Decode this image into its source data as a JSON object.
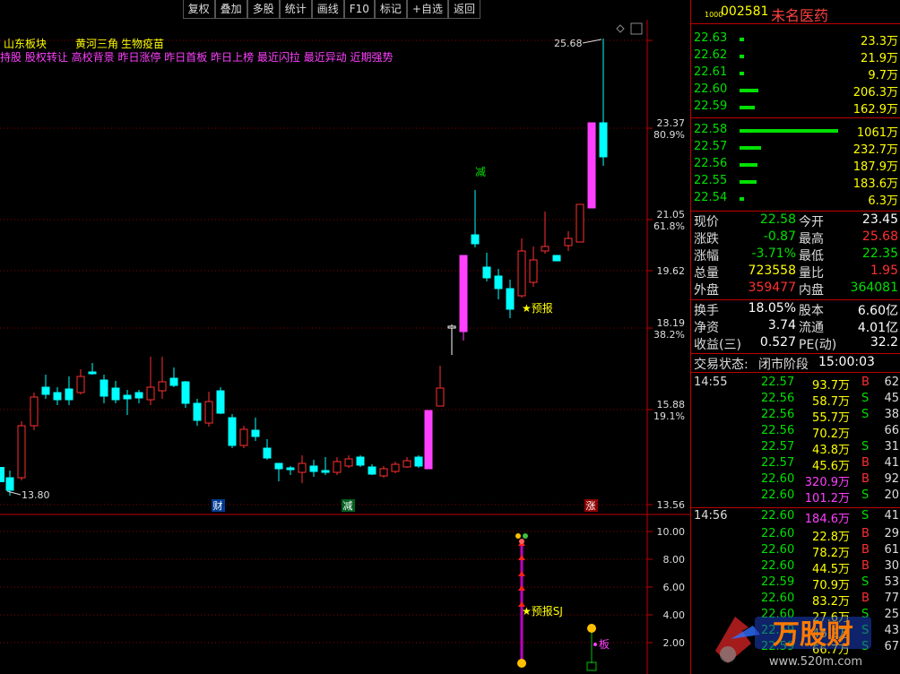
{
  "toolbar": {
    "buttons": [
      "复权",
      "叠加",
      "多股",
      "统计",
      "画线",
      "F10",
      "标记",
      "+自选",
      "返回"
    ]
  },
  "chart": {
    "blocks": [
      "山东板块",
      "黄河三角",
      "生物疫苗"
    ],
    "concepts": "持股 股权转让 高校背景 昨日涨停 昨日首板 昨日上榜 最近闪拉 最近异动 近期强势",
    "price_labels": [
      {
        "value": "25.68"
      },
      {
        "value": "23.37",
        "pct": "80.9%"
      },
      {
        "value": "21.05",
        "pct": "61.8%"
      },
      {
        "value": "19.62"
      },
      {
        "value": "18.19",
        "pct": "38.2%"
      },
      {
        "value": "15.88",
        "pct": "19.1%"
      },
      {
        "value": "13.56"
      }
    ],
    "low_label": "13.80",
    "high_label": "25.68",
    "markers": {
      "cai": "财",
      "jian1": "减",
      "jian2": "减",
      "zhang": "涨",
      "yubao": "★预报"
    },
    "sub_axis": [
      "10.00",
      "8.00",
      "6.00",
      "4.00",
      "2.00"
    ],
    "sub_labels": {
      "yubao_sj": "★预报SJ",
      "ban": "板"
    }
  },
  "stock": {
    "code": "002581",
    "name": "未名医药",
    "tag": "1000"
  },
  "orderbook": {
    "asks": [
      {
        "price": "22.63",
        "vol": "23.3万",
        "bar": 0.02
      },
      {
        "price": "22.62",
        "vol": "21.9万",
        "bar": 0.02
      },
      {
        "price": "22.61",
        "vol": "9.7万",
        "bar": 0.01
      },
      {
        "price": "22.60",
        "vol": "206.3万",
        "bar": 0.19
      },
      {
        "price": "22.59",
        "vol": "162.9万",
        "bar": 0.15
      }
    ],
    "bids": [
      {
        "price": "22.58",
        "vol": "1061万",
        "bar": 1.0
      },
      {
        "price": "22.57",
        "vol": "232.7万",
        "bar": 0.22
      },
      {
        "price": "22.56",
        "vol": "187.9万",
        "bar": 0.18
      },
      {
        "price": "22.55",
        "vol": "183.6万",
        "bar": 0.17
      },
      {
        "price": "22.54",
        "vol": "6.3万",
        "bar": 0.01
      }
    ]
  },
  "quote": [
    {
      "l1": "现价",
      "v1": "22.58",
      "c1": "g",
      "l2": "今开",
      "v2": "23.45",
      "c2": "w"
    },
    {
      "l1": "涨跌",
      "v1": "-0.87",
      "c1": "g",
      "l2": "最高",
      "v2": "25.68",
      "c2": "r"
    },
    {
      "l1": "涨幅",
      "v1": "-3.71%",
      "c1": "g",
      "l2": "最低",
      "v2": "22.35",
      "c2": "g"
    },
    {
      "l1": "总量",
      "v1": "723558",
      "c1": "y",
      "l2": "量比",
      "v2": "1.95",
      "c2": "r"
    },
    {
      "l1": "外盘",
      "v1": "359477",
      "c1": "r",
      "l2": "内盘",
      "v2": "364081",
      "c2": "g"
    }
  ],
  "quote2": [
    {
      "l1": "换手",
      "v1": "18.05%",
      "l2": "股本",
      "v2": "6.60亿"
    },
    {
      "l1": "净资",
      "v1": "3.74",
      "l2": "流通",
      "v2": "4.01亿"
    },
    {
      "l1": "收益(三)",
      "v1": "0.527",
      "l2": "PE(动)",
      "v2": "32.2"
    }
  ],
  "status": {
    "label": "交易状态:",
    "value": "闭市阶段",
    "time": "15:00:03"
  },
  "ticks": [
    {
      "time": "14:55",
      "price": "22.57",
      "vol": "93.7万",
      "vc": "y",
      "bs": "B",
      "num": "62"
    },
    {
      "time": "",
      "price": "22.56",
      "vol": "58.7万",
      "vc": "y",
      "bs": "S",
      "num": "45"
    },
    {
      "time": "",
      "price": "22.56",
      "vol": "55.7万",
      "vc": "y",
      "bs": "S",
      "num": "38"
    },
    {
      "time": "",
      "price": "22.56",
      "vol": "70.2万",
      "vc": "y",
      "bs": "",
      "num": "66"
    },
    {
      "time": "",
      "price": "22.57",
      "vol": "43.8万",
      "vc": "y",
      "bs": "S",
      "num": "31"
    },
    {
      "time": "",
      "price": "22.57",
      "vol": "45.6万",
      "vc": "y",
      "bs": "B",
      "num": "41"
    },
    {
      "time": "",
      "price": "22.60",
      "vol": "320.9万",
      "vc": "m",
      "bs": "B",
      "num": "92"
    },
    {
      "time": "",
      "price": "22.60",
      "vol": "101.2万",
      "vc": "m",
      "bs": "S",
      "num": "20"
    },
    {
      "time": "14:56",
      "price": "22.60",
      "vol": "184.6万",
      "vc": "m",
      "bs": "S",
      "num": "41"
    },
    {
      "time": "",
      "price": "22.60",
      "vol": "22.8万",
      "vc": "y",
      "bs": "B",
      "num": "29"
    },
    {
      "time": "",
      "price": "22.60",
      "vol": "78.2万",
      "vc": "y",
      "bs": "B",
      "num": "61"
    },
    {
      "time": "",
      "price": "22.60",
      "vol": "44.5万",
      "vc": "y",
      "bs": "B",
      "num": "30"
    },
    {
      "time": "",
      "price": "22.59",
      "vol": "70.9万",
      "vc": "y",
      "bs": "S",
      "num": "53"
    },
    {
      "time": "",
      "price": "22.60",
      "vol": "83.2万",
      "vc": "y",
      "bs": "B",
      "num": "77"
    },
    {
      "time": "",
      "price": "22.60",
      "vol": "27.6万",
      "vc": "y",
      "bs": "S",
      "num": "25"
    },
    {
      "time": "",
      "price": "22.59",
      "vol": "46.2万",
      "vc": "y",
      "bs": "S",
      "num": "43"
    },
    {
      "time": "",
      "price": "22.59",
      "vol": "66.7万",
      "vc": "y",
      "bs": "S",
      "num": "67"
    }
  ],
  "watermark": {
    "text": "万股财",
    "url": "www.520m.com"
  }
}
